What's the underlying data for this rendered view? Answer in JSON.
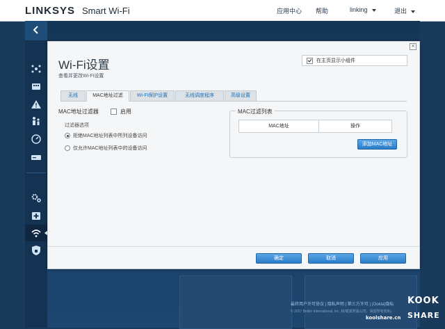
{
  "header": {
    "brand": "LINKSYS",
    "product": "Smart Wi-Fi",
    "nav": {
      "app_center": "应用中心",
      "help": "帮助",
      "user": "linking",
      "logout": "退出"
    }
  },
  "sidebar": {
    "back_icon": "chevron-left-icon",
    "items": [
      {
        "icon": "network-map-icon"
      },
      {
        "icon": "media-prioritization-icon"
      },
      {
        "icon": "alert-triangle-icon"
      },
      {
        "icon": "parental-controls-icon"
      },
      {
        "icon": "speed-test-icon"
      },
      {
        "icon": "external-storage-icon"
      },
      {
        "icon": "connectivity-gear-icon"
      },
      {
        "icon": "troubleshooting-icon"
      },
      {
        "icon": "wifi-settings-icon",
        "selected": true
      },
      {
        "icon": "security-shield-icon"
      }
    ]
  },
  "dialog": {
    "title": "Wi-Fi设置",
    "subtitle": "查看并更改Wi-Fi设置",
    "close_icon": "close-icon",
    "show_on_home": {
      "label": "在主页显示小组件",
      "checked": true
    },
    "tabs": [
      {
        "label": "无线",
        "active": false
      },
      {
        "label": "MAC地址过滤",
        "active": true
      },
      {
        "label": "Wi-Fi保护设置",
        "active": false
      },
      {
        "label": "无线调度程序",
        "active": false
      },
      {
        "label": "高级设置",
        "active": false
      }
    ],
    "mac_filter": {
      "label": "MAC地址过滤器",
      "enable_label": "启用",
      "enabled": false,
      "options_label": "过滤器选项",
      "option_deny": "拒绝MAC地址列表中所列设备访问",
      "option_allow": "仅允许MAC地址列表中的设备访问",
      "selected": "deny"
    },
    "mac_list": {
      "title": "MAC过滤列表",
      "col_mac": "MAC地址",
      "col_action": "操作",
      "add_button": "添加MAC地址"
    },
    "buttons": {
      "ok": "确定",
      "cancel": "取消",
      "apply": "应用"
    }
  },
  "footer": {
    "links": "最终用户许可协议 | 隐私声明 | 第三方许可 | (Ookla)隐私",
    "copyright": "© 2017 Belkin International, Inc. 和/或其附属公司。保留所有权利。"
  },
  "watermark": {
    "line1": "KOOK",
    "line2": "SHARE",
    "site": "koolshare.cn"
  },
  "colors": {
    "background": "#1a3a5c",
    "accent": "#2b7cc7",
    "tab_text": "#1f6fb5"
  }
}
